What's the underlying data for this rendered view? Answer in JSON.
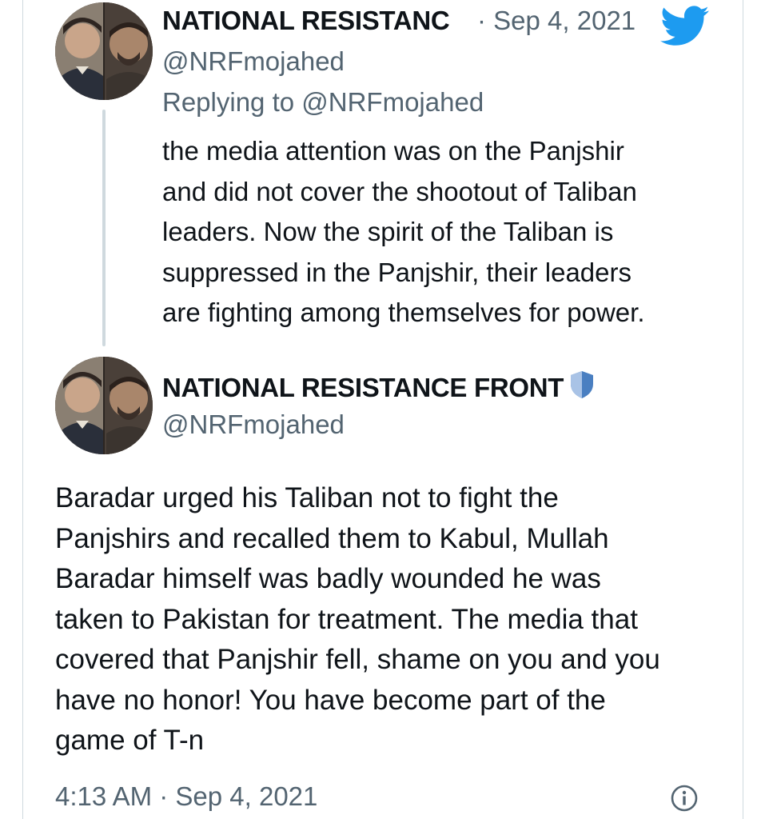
{
  "reply_tweet": {
    "author_name": "NATIONAL RESISTANC",
    "date_separator": "· Sep 4, 2021",
    "handle": "@NRFmojahed",
    "replying_prefix": "Replying to ",
    "replying_handle": "@NRFmojahed",
    "text": "the media attention was on the Panjshir\nand did not cover the shootout of Taliban\nleaders. Now the spirit of the Taliban is\nsuppressed in the Panjshir, their leaders\nare fighting among themselves for power."
  },
  "main_tweet": {
    "author_name": "NATIONAL RESISTANCE FRONT",
    "handle": "@NRFmojahed",
    "text": "Baradar urged his Taliban not to fight the\nPanjshirs and recalled them to Kabul, Mullah\nBaradar himself was badly wounded he was\ntaken to Pakistan for treatment. The media that\ncovered that Panjshir fell, shame on you and you\nhave no honor! You have become part of the\ngame of T-n",
    "timestamp": "4:13 AM · Sep 4, 2021"
  },
  "icons": {
    "brand": "twitter-bird-icon",
    "badge": "shield-icon",
    "info": "info-icon"
  },
  "colors": {
    "twitter_blue": "#1d9bf0",
    "secondary_text": "#536471",
    "primary_text": "#0f1419",
    "divider": "#cfd9de",
    "shield_blue": "#4a7fc1"
  }
}
